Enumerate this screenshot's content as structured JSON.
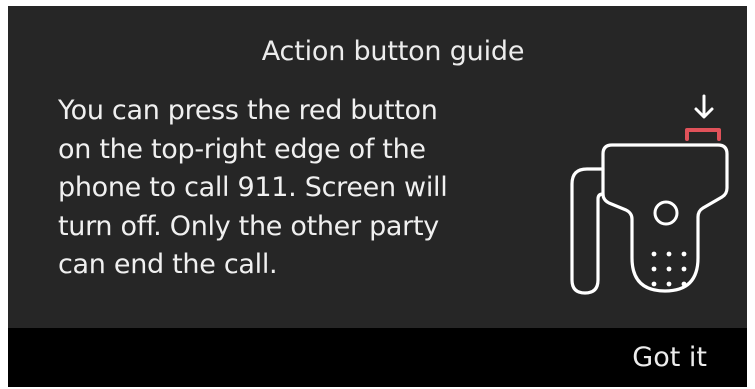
{
  "dialog": {
    "title": "Action button guide",
    "message": "You can press the red button\non the top-right edge of the\nphone to call 911. Screen will\nturn off. Only the other party\ncan end the call.",
    "illustration_icon": "desk-phone-red-button-icon",
    "accent_color": "#e0525a"
  },
  "footer": {
    "got_it_label": "Got it"
  }
}
